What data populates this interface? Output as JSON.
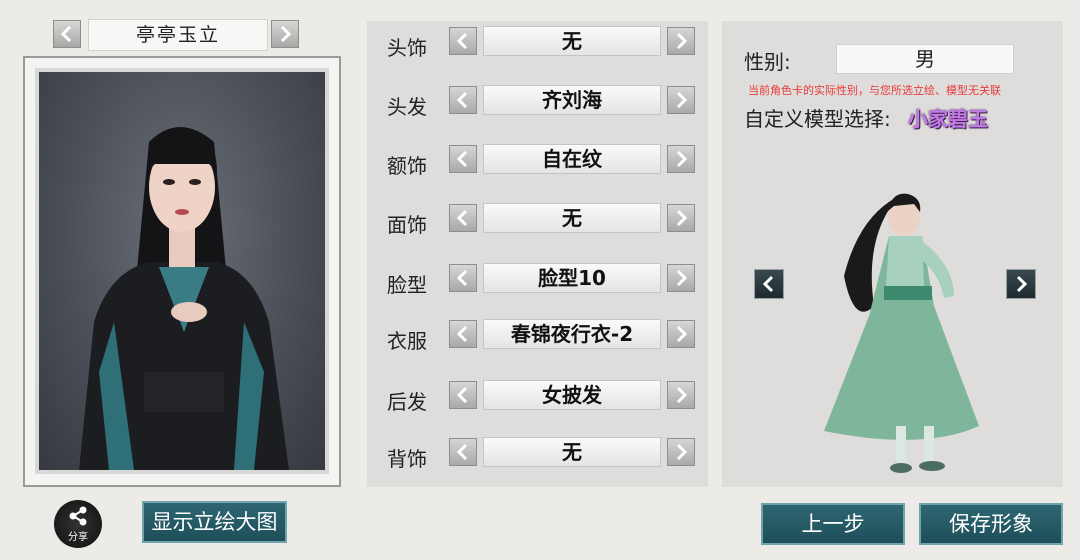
{
  "character": {
    "name": "亭亭玉立"
  },
  "appearance": {
    "rows": [
      {
        "label": "头饰",
        "value": "无"
      },
      {
        "label": "头发",
        "value": "齐刘海"
      },
      {
        "label": "额饰",
        "value": "自在纹"
      },
      {
        "label": "面饰",
        "value": "无"
      },
      {
        "label": "脸型",
        "value": "脸型10"
      },
      {
        "label": "衣服",
        "value": "春锦夜行衣-2"
      },
      {
        "label": "后发",
        "value": "女披发"
      },
      {
        "label": "背饰",
        "value": "无"
      }
    ]
  },
  "profile": {
    "gender_label": "性别:",
    "gender_value": "男",
    "gender_note": "当前角色卡的实际性别，与您所选立绘、模型无关联",
    "model_label": "自定义模型选择:",
    "model_name": "小家碧玉"
  },
  "actions": {
    "share_label": "分享",
    "show_portrait": "显示立绘大图",
    "prev_step": "上一步",
    "save_appearance": "保存形象"
  },
  "colors": {
    "accent_button": "#245865",
    "model_name": "#c37ae6",
    "note": "#e83b3b"
  }
}
